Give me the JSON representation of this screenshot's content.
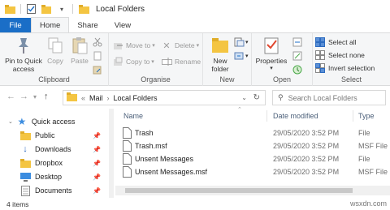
{
  "window": {
    "title": "Local Folders"
  },
  "tabs": [
    {
      "label": "File"
    },
    {
      "label": "Home"
    },
    {
      "label": "Share"
    },
    {
      "label": "View"
    }
  ],
  "ribbon": {
    "clipboard": {
      "label": "Clipboard",
      "pin": "Pin to Quick access",
      "copy": "Copy",
      "paste": "Paste"
    },
    "organise": {
      "label": "Organise",
      "move_to": "Move to",
      "copy_to": "Copy to",
      "delete": "Delete",
      "rename": "Rename"
    },
    "new": {
      "label": "New",
      "new_folder": "New folder"
    },
    "open": {
      "label": "Open",
      "properties": "Properties"
    },
    "select": {
      "label": "Select",
      "select_all": "Select all",
      "select_none": "Select none",
      "invert": "Invert selection"
    }
  },
  "address": {
    "crumbs": [
      "Mail",
      "Local Folders"
    ],
    "search_placeholder": "Search Local Folders"
  },
  "nav": [
    {
      "label": "Quick access"
    },
    {
      "label": "Public"
    },
    {
      "label": "Downloads"
    },
    {
      "label": "Dropbox"
    },
    {
      "label": "Desktop"
    },
    {
      "label": "Documents"
    }
  ],
  "columns": {
    "name": "Name",
    "date": "Date modified",
    "type": "Type"
  },
  "files": [
    {
      "name": "Trash",
      "date": "29/05/2020 3:52 PM",
      "type": "File"
    },
    {
      "name": "Trash.msf",
      "date": "29/05/2020 3:52 PM",
      "type": "MSF File"
    },
    {
      "name": "Unsent Messages",
      "date": "29/05/2020 3:52 PM",
      "type": "File"
    },
    {
      "name": "Unsent Messages.msf",
      "date": "29/05/2020 3:52 PM",
      "type": "MSF File"
    }
  ],
  "status": {
    "count": "4 items"
  },
  "watermark": "wsxdn.com",
  "colors": {
    "accent": "#1a6ec7",
    "folder": "#f4c542"
  }
}
